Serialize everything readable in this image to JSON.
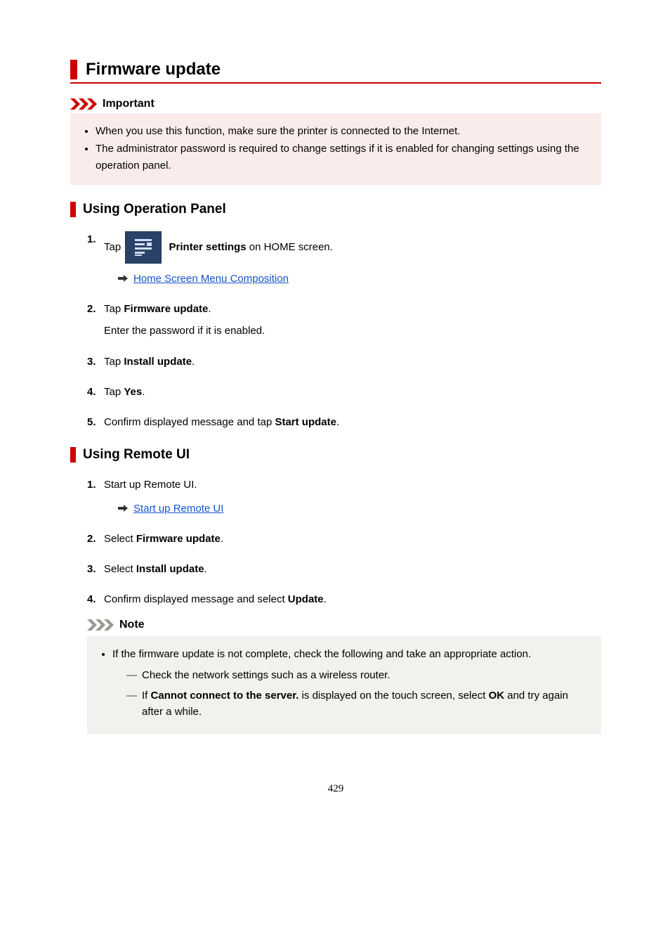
{
  "title": "Firmware update",
  "important": {
    "label": "Important",
    "items": [
      "When you use this function, make sure the printer is connected to the Internet.",
      "The administrator password is required to change settings if it is enabled for changing settings using the operation panel."
    ]
  },
  "section1": {
    "heading": "Using Operation Panel",
    "steps": {
      "s1": {
        "pre": "Tap",
        "bold": "Printer settings",
        "post": " on HOME screen.",
        "link": "Home Screen Menu Composition"
      },
      "s2": {
        "head_pre": "Tap ",
        "head_bold": "Firmware update",
        "head_post": ".",
        "sub": "Enter the password if it is enabled."
      },
      "s3": {
        "pre": "Tap ",
        "bold": "Install update",
        "post": "."
      },
      "s4": {
        "pre": "Tap ",
        "bold": "Yes",
        "post": "."
      },
      "s5": {
        "pre": "Confirm displayed message and tap ",
        "bold": "Start update",
        "post": "."
      }
    }
  },
  "section2": {
    "heading": "Using Remote UI",
    "steps": {
      "s1": {
        "text": "Start up Remote UI.",
        "link": "Start up Remote UI"
      },
      "s2": {
        "pre": "Select ",
        "bold": "Firmware update",
        "post": "."
      },
      "s3": {
        "pre": "Select ",
        "bold": "Install update",
        "post": "."
      },
      "s4": {
        "pre": "Confirm displayed message and select ",
        "bold": "Update",
        "post": "."
      }
    },
    "note": {
      "label": "Note",
      "intro": "If the firmware update is not complete, check the following and take an appropriate action.",
      "dash1": "Check the network settings such as a wireless router.",
      "dash2_pre": "If ",
      "dash2_bold1": "Cannot connect to the server.",
      "dash2_mid": " is displayed on the touch screen, select ",
      "dash2_bold2": "OK",
      "dash2_post": " and try again after a while."
    }
  },
  "page_number": "429"
}
